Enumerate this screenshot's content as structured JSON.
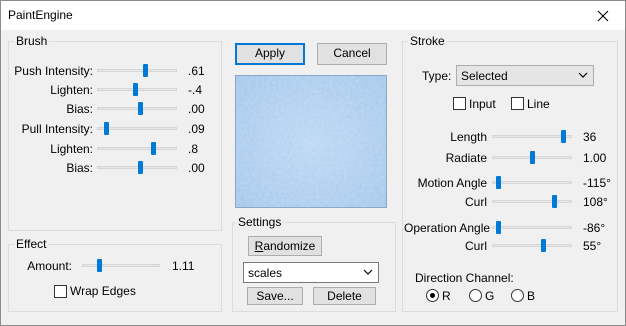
{
  "window": {
    "title": "PaintEngine"
  },
  "brush": {
    "label": "Brush",
    "rows": [
      {
        "label": "Push Intensity:",
        "value": ".61",
        "level": 0.61
      },
      {
        "label": "Lighten:",
        "value": "-.4",
        "level": 0.48
      },
      {
        "label": "Bias:",
        "value": ".00",
        "level": 0.55
      },
      {
        "label": "Pull Intensity:",
        "value": ".09",
        "level": 0.09
      },
      {
        "label": "Lighten:",
        "value": ".8",
        "level": 0.72
      },
      {
        "label": "Bias:",
        "value": ".00",
        "level": 0.55
      }
    ]
  },
  "effect": {
    "label": "Effect",
    "amount_label": "Amount:",
    "amount_value": "1.11",
    "amount_level": 0.2,
    "wrap_edges_label": "Wrap Edges",
    "wrap_edges_checked": false
  },
  "actions": {
    "apply": "Apply",
    "cancel": "Cancel"
  },
  "settings": {
    "label": "Settings",
    "randomize_rest": "andomize",
    "randomize_mnemonic": "R",
    "preset_value": "scales",
    "save": "Save...",
    "delete": "Delete"
  },
  "stroke": {
    "label": "Stroke",
    "type_label": "Type:",
    "type_value": "Selected",
    "input_label": "Input",
    "line_label": "Line",
    "rows": [
      {
        "label": "Length",
        "value": "36",
        "level": 0.92
      },
      {
        "label": "Radiate",
        "value": "1.00",
        "level": 0.5
      },
      {
        "label": "Motion Angle",
        "value": "-115°",
        "level": 0.05
      },
      {
        "label": "Curl",
        "value": "108°",
        "level": 0.8
      },
      {
        "label": "Operation Angle",
        "value": "-86°",
        "level": 0.05
      },
      {
        "label": "Curl",
        "value": "55°",
        "level": 0.65
      }
    ],
    "direction_label": "Direction Channel:",
    "channels": [
      "R",
      "G",
      "B"
    ],
    "selected_channel": "R"
  },
  "colors": {
    "thumb": "#007ad9",
    "preview": "#a9cbee",
    "button_face": "#e1e1e1",
    "default_border": "#0078d7"
  }
}
